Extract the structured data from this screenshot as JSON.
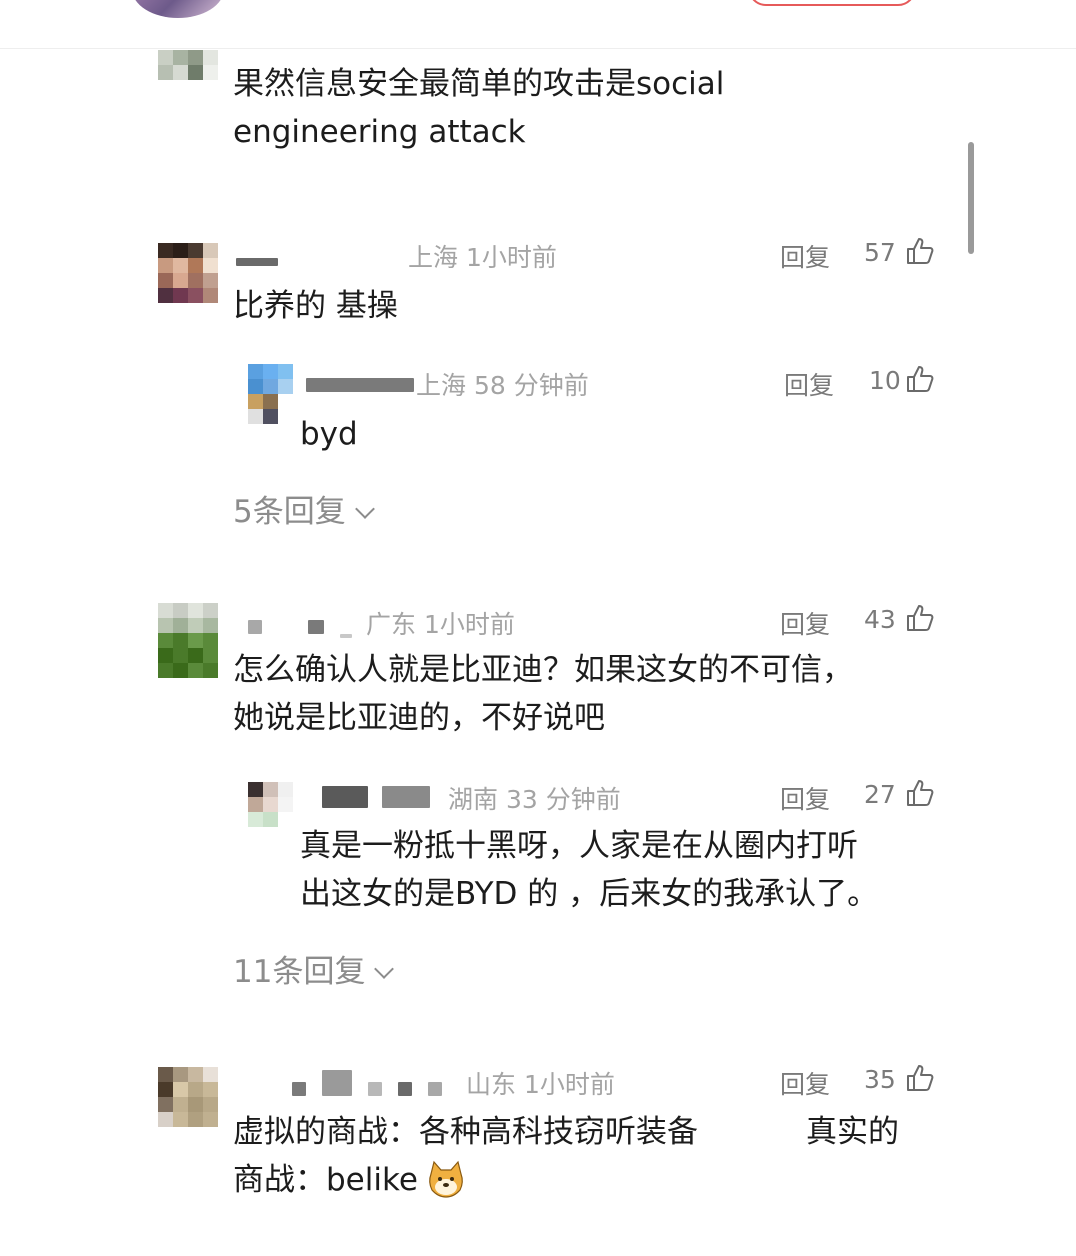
{
  "comments": [
    {
      "text_line1": "果然信息安全最简单的攻击是social",
      "text_line2": "engineering attack"
    },
    {
      "location_time": "上海 1小时前",
      "reply_label": "回复",
      "likes": "57",
      "text": "比养的 基操",
      "sub": {
        "location_time": "上海 58 分钟前",
        "reply_label": "回复",
        "likes": "10",
        "text": "byd"
      },
      "more_replies": "5条回复"
    },
    {
      "location_time": "广东 1小时前",
      "reply_label": "回复",
      "likes": "43",
      "text_line1": "怎么确认人就是比亚迪？如果这女的不可信，",
      "text_line2": "她说是比亚迪的，不好说吧",
      "sub": {
        "location_time": "湖南 33 分钟前",
        "reply_label": "回复",
        "likes": "27",
        "text_line1": "真是一粉抵十黑呀，人家是在从圈内打听",
        "text_line2": "出这女的是BYD 的 ，后来女的我承认了。"
      },
      "more_replies": "11条回复"
    },
    {
      "location_time": "山东 1小时前",
      "reply_label": "回复",
      "likes": "35",
      "text_line1": "虚拟的商战：各种高科技窃听装备",
      "text_line1b": "真实的",
      "text_line2": "商战：belike",
      "emoji": "doge-emoji"
    }
  ],
  "icons": {
    "like": "thumbs-up-icon",
    "expand": "chevron-down-icon"
  },
  "colors": {
    "meta": "#a4a4a4",
    "body": "#1c1c1c",
    "follow_border": "#e65a5a"
  }
}
